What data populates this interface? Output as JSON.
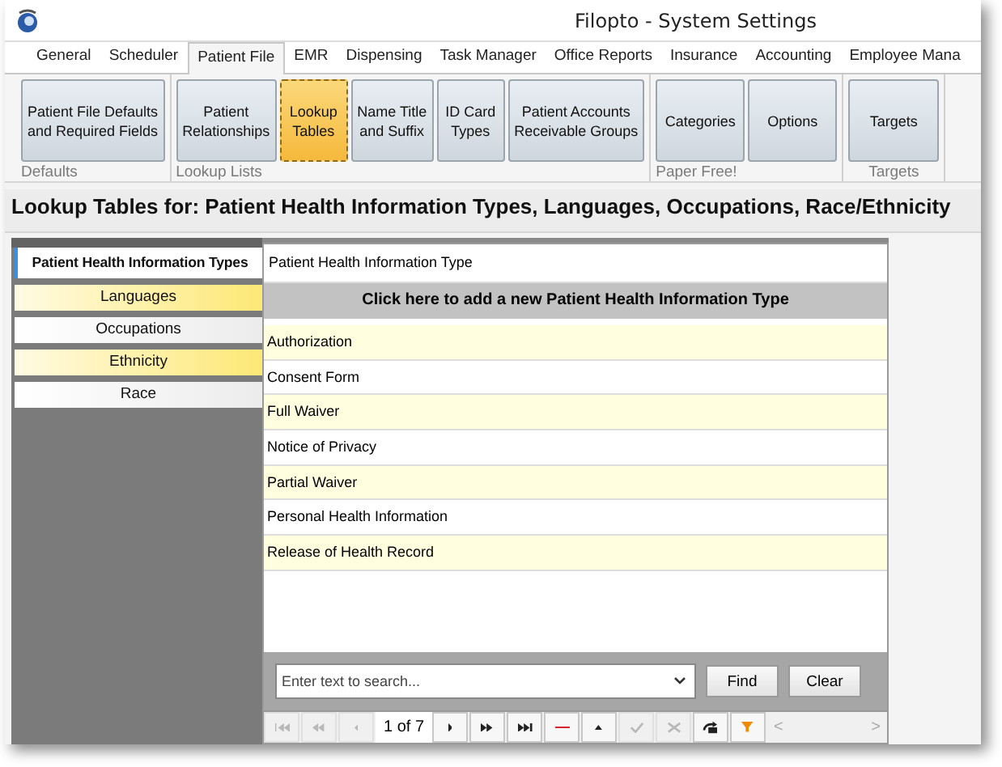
{
  "window": {
    "title": "Filopto - System Settings"
  },
  "tabs": [
    {
      "label": "General",
      "selected": false
    },
    {
      "label": "Scheduler",
      "selected": false
    },
    {
      "label": "Patient File",
      "selected": true
    },
    {
      "label": "EMR",
      "selected": false
    },
    {
      "label": "Dispensing",
      "selected": false
    },
    {
      "label": "Task Manager",
      "selected": false
    },
    {
      "label": "Office Reports",
      "selected": false
    },
    {
      "label": "Insurance",
      "selected": false
    },
    {
      "label": "Accounting",
      "selected": false
    },
    {
      "label": "Employee Mana",
      "selected": false
    }
  ],
  "ribbon": {
    "groups": [
      {
        "label": "Defaults",
        "buttons": [
          {
            "lines": [
              "Patient File Defaults",
              "and Required Fields"
            ],
            "selected": false
          }
        ]
      },
      {
        "label": "Lookup Lists",
        "buttons": [
          {
            "lines": [
              "Patient",
              "Relationships"
            ],
            "selected": false
          },
          {
            "lines": [
              "Lookup",
              "Tables"
            ],
            "selected": true
          },
          {
            "lines": [
              "Name Title",
              "and Suffix"
            ],
            "selected": false
          },
          {
            "lines": [
              "ID Card",
              "Types"
            ],
            "selected": false
          },
          {
            "lines": [
              "Patient Accounts",
              "Receivable Groups"
            ],
            "selected": false
          }
        ]
      },
      {
        "label": "Paper Free!",
        "buttons": [
          {
            "lines": [
              "Categories"
            ],
            "selected": false
          },
          {
            "lines": [
              "Options"
            ],
            "selected": false
          }
        ]
      },
      {
        "label": "Targets",
        "buttons": [
          {
            "lines": [
              "Targets"
            ],
            "selected": false
          }
        ]
      }
    ]
  },
  "heading": "Lookup Tables for: Patient Health Information Types, Languages, Occupations, Race/Ethnicity",
  "sidebar": {
    "items": [
      {
        "label": "Patient Health Information Types",
        "selected": true
      },
      {
        "label": "Languages",
        "selected": false
      },
      {
        "label": "Occupations",
        "selected": false
      },
      {
        "label": "Ethnicity",
        "selected": false
      },
      {
        "label": "Race",
        "selected": false
      }
    ]
  },
  "table": {
    "column": "Patient Health Information Type",
    "add_row": "Click here to add a new Patient Health Information Type",
    "rows": [
      "Authorization",
      "Consent Form",
      "Full Waiver",
      "Notice of Privacy",
      "Partial Waiver",
      "Personal Health Information",
      "Release of Health Record"
    ]
  },
  "search": {
    "placeholder": "Enter text to search...",
    "buttons": [
      "Find",
      "Clear"
    ]
  },
  "navigator": {
    "page": "1 of 7",
    "buttons": [
      {
        "kind": "first",
        "disabled": true
      },
      {
        "kind": "prev-page",
        "disabled": true
      },
      {
        "kind": "prev",
        "disabled": true
      },
      {
        "kind": "page"
      },
      {
        "kind": "next",
        "disabled": false
      },
      {
        "kind": "next-page",
        "disabled": false
      },
      {
        "kind": "last",
        "disabled": false
      },
      {
        "kind": "remove",
        "disabled": false
      },
      {
        "kind": "up",
        "disabled": false
      },
      {
        "kind": "accept",
        "disabled": true
      },
      {
        "kind": "cancel",
        "disabled": true
      },
      {
        "kind": "refresh",
        "disabled": false
      },
      {
        "kind": "filter",
        "disabled": false
      }
    ],
    "scroll": [
      "<",
      ">"
    ]
  }
}
